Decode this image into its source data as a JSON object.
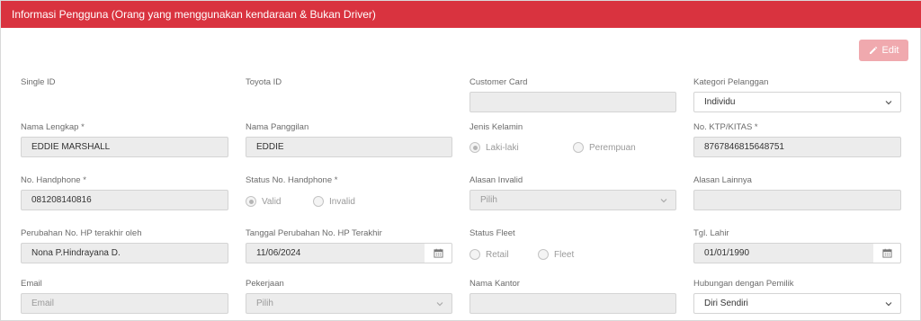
{
  "header": {
    "title": "Informasi Pengguna (Orang yang menggunakan kendaraan & Bukan Driver)"
  },
  "toolbar": {
    "edit_label": "Edit"
  },
  "colors": {
    "header_bg": "#d9333f",
    "edit_btn_bg": "#f0a9ae",
    "field_bg": "#ececec"
  },
  "row1": {
    "single_id_label": "Single ID",
    "toyota_id_label": "Toyota ID",
    "customer_card_label": "Customer Card",
    "customer_card_value": "",
    "kategori_label": "Kategori Pelanggan",
    "kategori_value": "Individu"
  },
  "row2": {
    "nama_lengkap_label": "Nama Lengkap *",
    "nama_lengkap_value": "EDDIE MARSHALL",
    "nama_panggilan_label": "Nama Panggilan",
    "nama_panggilan_value": "EDDIE",
    "jenis_kelamin_label": "Jenis Kelamin",
    "jenis_kelamin_options": [
      "Laki-laki",
      "Perempuan"
    ],
    "jenis_kelamin_selected": "Laki-laki",
    "ktp_label": "No. KTP/KITAS *",
    "ktp_value": "8767846815648751"
  },
  "row3": {
    "handphone_label": "No. Handphone *",
    "handphone_value": "081208140816",
    "status_hp_label": "Status No. Handphone *",
    "status_hp_options": [
      "Valid",
      "Invalid"
    ],
    "status_hp_selected": "Valid",
    "alasan_invalid_label": "Alasan Invalid",
    "alasan_invalid_value": "Pilih",
    "alasan_lainnya_label": "Alasan Lainnya",
    "alasan_lainnya_value": ""
  },
  "row4": {
    "perubahan_label": "Perubahan No. HP terakhir oleh",
    "perubahan_value": "Nona P.Hindrayana D.",
    "tanggal_label": "Tanggal Perubahan No. HP Terakhir",
    "tanggal_value": "11/06/2024",
    "status_fleet_label": "Status Fleet",
    "status_fleet_options": [
      "Retail",
      "Fleet"
    ],
    "tgl_lahir_label": "Tgl. Lahir",
    "tgl_lahir_value": "01/01/1990"
  },
  "row5": {
    "email_label": "Email",
    "email_placeholder": "Email",
    "pekerjaan_label": "Pekerjaan",
    "pekerjaan_value": "Pilih",
    "nama_kantor_label": "Nama Kantor",
    "nama_kantor_value": "",
    "hubungan_label": "Hubungan dengan Pemilik",
    "hubungan_value": "Diri Sendiri"
  }
}
